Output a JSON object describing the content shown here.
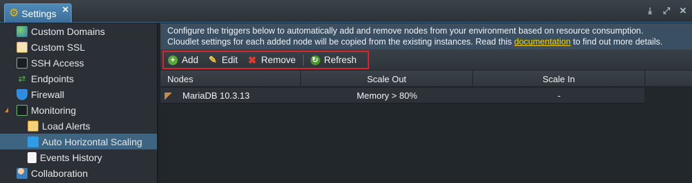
{
  "tab": {
    "label": "Settings",
    "icon": "gear-icon"
  },
  "window_controls": [
    "download-icon",
    "expand-icon",
    "close-icon"
  ],
  "sidebar": {
    "items": [
      {
        "label": "Custom Domains",
        "icon": "globe-icon"
      },
      {
        "label": "Custom SSL",
        "icon": "certificate-icon"
      },
      {
        "label": "SSH Access",
        "icon": "terminal-icon"
      },
      {
        "label": "Endpoints",
        "icon": "endpoints-icon"
      },
      {
        "label": "Firewall",
        "icon": "shield-icon"
      },
      {
        "label": "Monitoring",
        "icon": "monitor-chart-icon",
        "expanded": true
      },
      {
        "label": "Load Alerts",
        "icon": "mail-alert-icon"
      },
      {
        "label": "Auto Horizontal Scaling",
        "icon": "scaling-icon",
        "selected": true
      },
      {
        "label": "Events History",
        "icon": "document-icon"
      },
      {
        "label": "Collaboration",
        "icon": "users-icon"
      }
    ]
  },
  "description": {
    "line1": "Configure the triggers below to automatically add and remove nodes from your environment based on resource consumption.",
    "line2_before": "Cloudlet settings for each added node will be copied from the existing instances. Read this ",
    "link": "documentation",
    "line2_after": " to find out more details."
  },
  "toolbar": {
    "add_label": "Add",
    "edit_label": "Edit",
    "remove_label": "Remove",
    "refresh_label": "Refresh"
  },
  "grid": {
    "columns": [
      "Nodes",
      "Scale Out",
      "Scale In"
    ],
    "rows": [
      {
        "node": "MariaDB 10.3.13",
        "icon": "mariadb-seal-icon",
        "scale_out": "Memory > 80%",
        "scale_in": "-"
      }
    ]
  },
  "colors": {
    "accent": "#3d6480",
    "highlight_border": "#e0202a",
    "link": "#f5d000"
  }
}
